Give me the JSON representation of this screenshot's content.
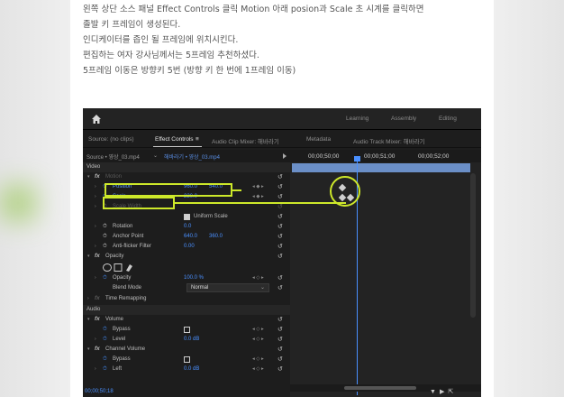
{
  "article": {
    "lines": [
      "왼쪽 상단 소스 패널 Effect Controls 클릭 Motion 아래 posion과 Scale 초 시계를 클릭하면",
      "졸발 키 프레임이 생성된다.",
      "인디케이터를 좁인 될 프레임에 위치시킨다.",
      "편집하는 여자 강사님께서는 5프레임 추천하셨다.",
      "5프레임 이동은 방향키 5번 (방향 키 한 번에 1프레임 이동)"
    ]
  },
  "premiere": {
    "workspaces": [
      "Learning",
      "Assembly",
      "Editing"
    ],
    "tabs": {
      "source": "Source: (no clips)",
      "effect_controls": "Effect Controls",
      "effect_controls_menu": "≡",
      "audio_clip_mixer": "Audio Clip Mixer: 해바라기",
      "metadata": "Metadata",
      "audio_track_mixer": "Audio Track Mixer: 해바라기"
    },
    "source_row": {
      "source": "Source • 영상_03.mp4",
      "chevron": "⌄",
      "clip": "해바라기 • 영상_03.mp4"
    },
    "timecodes": [
      "00;00;50;00",
      "00;00;51;00",
      "00;00;52;00"
    ],
    "sections": {
      "video": "Video",
      "motion": "Motion",
      "opacity": "Opacity",
      "time_remapping": "Time Remapping",
      "audio": "Audio",
      "volume": "Volume",
      "channel_volume": "Channel Volume"
    },
    "props": {
      "position": {
        "label": "Position",
        "x": "960.0",
        "y": "540.0"
      },
      "scale": {
        "label": "Scale",
        "value": "220.0"
      },
      "scale_width": {
        "label": "Scale Width"
      },
      "uniform_scale": {
        "label": "Uniform Scale"
      },
      "rotation": {
        "label": "Rotation",
        "value": "0.0"
      },
      "anchor_point": {
        "label": "Anchor Point",
        "x": "640.0",
        "y": "360.0"
      },
      "anti_flicker": {
        "label": "Anti-flicker Filter",
        "value": "0.00"
      },
      "opacity": {
        "label": "Opacity",
        "value": "100.0 %"
      },
      "blend_mode": {
        "label": "Blend Mode",
        "value": "Normal"
      },
      "bypass": {
        "label": "Bypass"
      },
      "level": {
        "label": "Level",
        "value": "0.0 dB"
      },
      "bypass2": {
        "label": "Bypass"
      },
      "left": {
        "label": "Left",
        "value": "0.0 dB"
      }
    },
    "status_timecode": "00;00;50;18",
    "colors": {
      "accent_blue": "#4a90ff",
      "highlight": "#cde82a",
      "panel_bg": "#1d1d1d"
    },
    "icons": [
      "home-icon",
      "stopwatch-icon",
      "reset-icon",
      "keyframe-icon",
      "filter-icon",
      "export-icon"
    ]
  }
}
